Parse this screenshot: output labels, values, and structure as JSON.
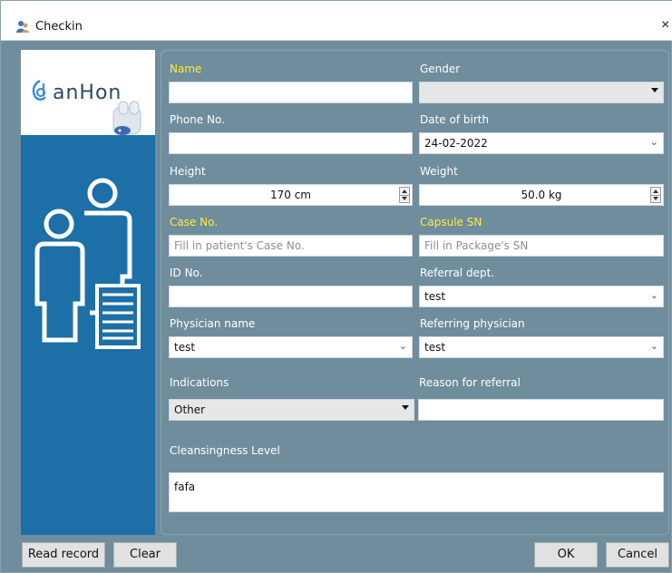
{
  "window": {
    "title": "Checkin",
    "close_glyph": "×"
  },
  "logo": {
    "brand": "anHon"
  },
  "form": {
    "name": {
      "label": "Name",
      "value": ""
    },
    "gender": {
      "label": "Gender",
      "value": ""
    },
    "phone": {
      "label": "Phone No.",
      "value": ""
    },
    "dob": {
      "label": "Date of birth",
      "value": "24-02-2022"
    },
    "height": {
      "label": "Height",
      "value": "170 cm"
    },
    "weight": {
      "label": "Weight",
      "value": "50.0 kg"
    },
    "case_no": {
      "label": "Case No.",
      "placeholder": "Fill in patient's Case No."
    },
    "capsule_sn": {
      "label": "Capsule SN",
      "placeholder": "Fill in Package's SN"
    },
    "id_no": {
      "label": "ID No.",
      "value": ""
    },
    "referral_dept": {
      "label": "Referral dept.",
      "value": "test"
    },
    "physician": {
      "label": "Physician name",
      "value": "test"
    },
    "referring_physician": {
      "label": "Referring physician",
      "value": "test"
    },
    "indications": {
      "label": "Indications",
      "value": "Other"
    },
    "reason": {
      "label": "Reason for referral",
      "value": ""
    },
    "cleansing": {
      "label": "Cleansingness Level",
      "value": "fafa"
    }
  },
  "buttons": {
    "read_record": "Read record",
    "clear": "Clear",
    "ok": "OK",
    "cancel": "Cancel"
  },
  "colors": {
    "required_label": "#ffef3a",
    "panel": "#6f8d9d",
    "side": "#1d6fa8"
  }
}
